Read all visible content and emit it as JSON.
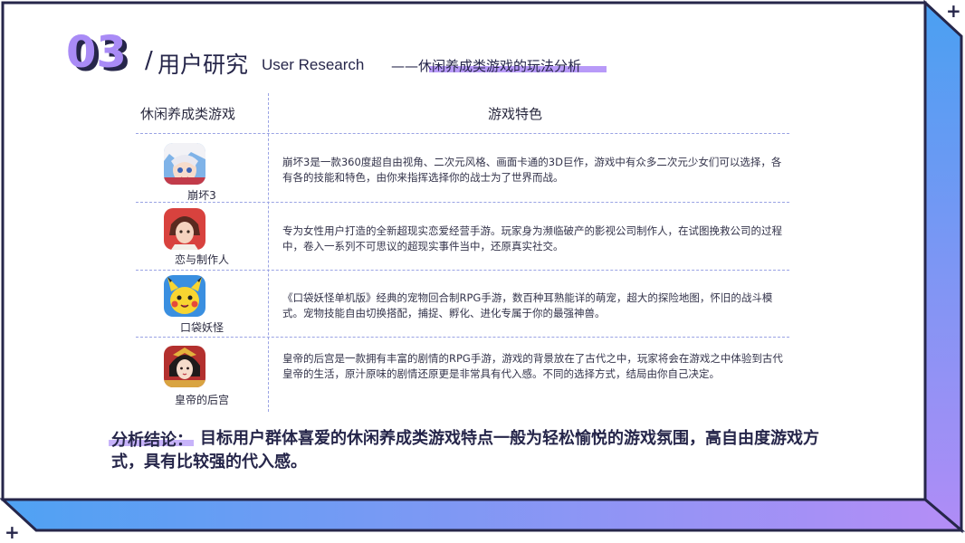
{
  "header": {
    "section_number": "03",
    "slash": "/",
    "title": "用户研究",
    "title_en": "User Research",
    "subtitle": "——休闲养成类游戏的玩法分析"
  },
  "table": {
    "col_game": "休闲养成类游戏",
    "col_feature": "游戏特色",
    "rows": [
      {
        "name": "崩坏3",
        "icon": "honkai-character-icon",
        "desc": "崩坏3是一款360度超自由视角、二次元风格、画面卡通的3D巨作，游戏中有众多二次元少女们可以选择，各有各的技能和特色，由你来指挥选择你的战士为了世界而战。"
      },
      {
        "name": "恋与制作人",
        "icon": "love-producer-character-icon",
        "desc": "专为女性用户打造的全新超现实恋爱经营手游。玩家身为濒临破产的影视公司制作人，在试图挽救公司的过程中，卷入一系列不可思议的超现实事件当中，还原真实社交。"
      },
      {
        "name": "口袋妖怪",
        "icon": "pikachu-icon",
        "desc": "《口袋妖怪单机版》经典的宠物回合制RPG手游，数百种耳熟能详的萌宠，超大的探险地图，怀旧的战斗模式。宠物技能自由切换搭配，捕捉、孵化、进化专属于你的最强神兽。"
      },
      {
        "name": "皇帝的后宫",
        "icon": "empress-character-icon",
        "desc": "皇帝的后宫是一款拥有丰富的剧情的RPG手游，游戏的背景放在了古代之中，玩家将会在游戏之中体验到古代皇帝的生活，原汁原味的剧情还原更是非常具有代入感。不同的选择方式，结局由你自己决定。"
      }
    ]
  },
  "conclusion": {
    "label": "分析结论：",
    "text": "目标用户群体喜爱的休闲养成类游戏特点一般为轻松愉悦的游戏氛围，高自由度游戏方式，具有比较强的代入感。"
  },
  "colors": {
    "accent_purple": "#a98bf6",
    "frame_dark": "#26264a",
    "gradient_blue": "#4fa2f3",
    "gradient_purple": "#b58df6"
  },
  "decor": {
    "plus": "+"
  }
}
